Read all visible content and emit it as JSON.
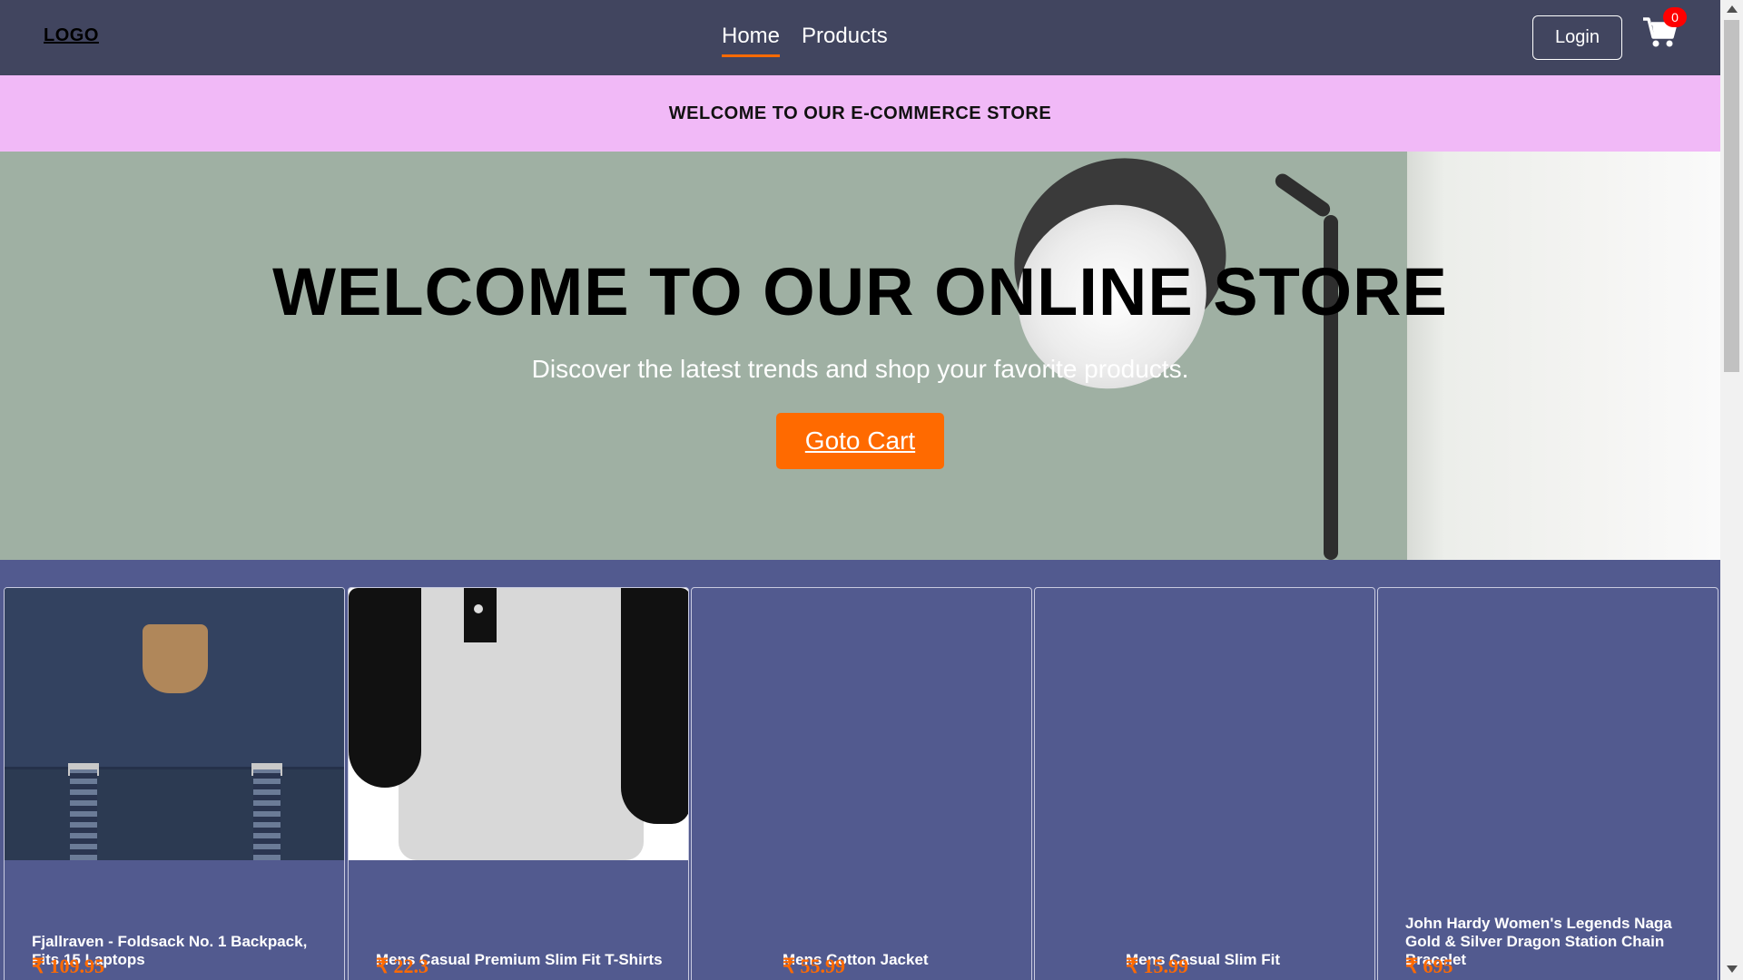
{
  "navbar": {
    "logo": "LOGO",
    "links": [
      {
        "label": "Home",
        "active": true
      },
      {
        "label": "Products",
        "active": false
      }
    ],
    "login_label": "Login",
    "cart_count": "0",
    "cart_icon": "cart-icon"
  },
  "banner": {
    "text": "WELCOME TO OUR E-COMMERCE STORE"
  },
  "hero": {
    "title": "WELCOME TO OUR ONLINE STORE",
    "subtitle": "Discover the latest trends and shop your favorite products.",
    "button_label": "Goto Cart"
  },
  "products": [
    {
      "title": "Fjallraven - Foldsack No. 1 Backpack, Fits 15 Laptops",
      "price": "₹ 109.95"
    },
    {
      "title": "Mens Casual Premium Slim Fit T-Shirts",
      "price": "₹ 22.3"
    },
    {
      "title": "Mens Cotton Jacket",
      "price": "₹ 55.99"
    },
    {
      "title": "Mens Casual Slim Fit",
      "price": "₹ 15.99"
    },
    {
      "title": "John Hardy Women's Legends Naga Gold & Silver Dragon Station Chain Bracelet",
      "price": "₹ 695"
    }
  ],
  "colors": {
    "navbar_bg": "#41455f",
    "banner_bg": "#f1b9f7",
    "accent": "#ff6a00",
    "products_bg": "#525a8f",
    "badge": "#ff0000"
  }
}
